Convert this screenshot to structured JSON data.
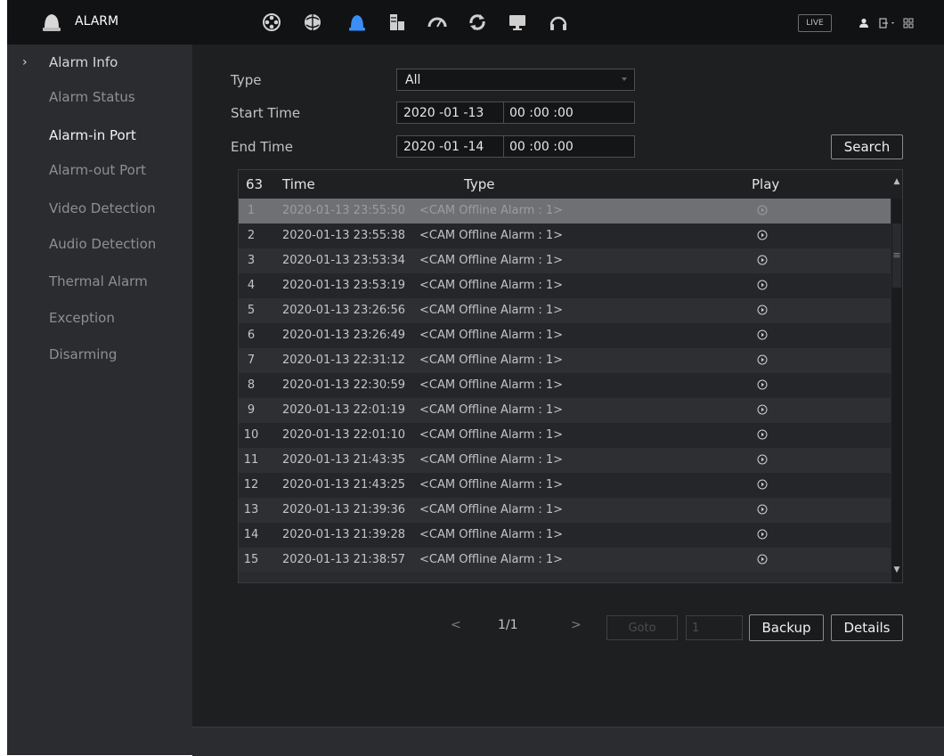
{
  "header": {
    "title": "ALARM",
    "tools": [
      {
        "icon": "camera-reel-icon",
        "label": "Camera"
      },
      {
        "icon": "network-icon",
        "label": "Network"
      },
      {
        "icon": "alarm-bell-icon",
        "label": "Alarm"
      },
      {
        "icon": "storage-icon",
        "label": "Storage"
      },
      {
        "icon": "gauge-icon",
        "label": "System"
      },
      {
        "icon": "refresh-icon",
        "label": "Maintain"
      },
      {
        "icon": "monitor-icon",
        "label": "Display"
      },
      {
        "icon": "headset-icon",
        "label": "Audio"
      }
    ],
    "live_label": "LIVE",
    "active_color": "#3a8ef6"
  },
  "sidebar": {
    "items": [
      {
        "label": "Alarm Info"
      },
      {
        "label": "Alarm Status"
      },
      {
        "label": "Alarm-in Port"
      },
      {
        "label": "Alarm-out Port"
      },
      {
        "label": "Video Detection"
      },
      {
        "label": "Audio Detection"
      },
      {
        "label": "Thermal Alarm"
      },
      {
        "label": "Exception"
      },
      {
        "label": "Disarming"
      }
    ]
  },
  "form": {
    "type_label": "Type",
    "type_value": "All",
    "start_label": "Start Time",
    "start_date": "2020 -01 -13",
    "start_time": "00 :00 :00",
    "end_label": "End Time",
    "end_date": "2020 -01 -14",
    "end_time": "00 :00 :00",
    "search_label": "Search"
  },
  "table": {
    "count": "63",
    "col_time": "Time",
    "col_type": "Type",
    "col_play": "Play",
    "rows": [
      {
        "no": "1",
        "time": "2020-01-13 23:55:50",
        "type": "<CAM Offline Alarm : 1>"
      },
      {
        "no": "2",
        "time": "2020-01-13 23:55:38",
        "type": "<CAM Offline Alarm : 1>"
      },
      {
        "no": "3",
        "time": "2020-01-13 23:53:34",
        "type": "<CAM Offline Alarm : 1>"
      },
      {
        "no": "4",
        "time": "2020-01-13 23:53:19",
        "type": "<CAM Offline Alarm : 1>"
      },
      {
        "no": "5",
        "time": "2020-01-13 23:26:56",
        "type": "<CAM Offline Alarm : 1>"
      },
      {
        "no": "6",
        "time": "2020-01-13 23:26:49",
        "type": "<CAM Offline Alarm : 1>"
      },
      {
        "no": "7",
        "time": "2020-01-13 22:31:12",
        "type": "<CAM Offline Alarm : 1>"
      },
      {
        "no": "8",
        "time": "2020-01-13 22:30:59",
        "type": "<CAM Offline Alarm : 1>"
      },
      {
        "no": "9",
        "time": "2020-01-13 22:01:19",
        "type": "<CAM Offline Alarm : 1>"
      },
      {
        "no": "10",
        "time": "2020-01-13 22:01:10",
        "type": "<CAM Offline Alarm : 1>"
      },
      {
        "no": "11",
        "time": "2020-01-13 21:43:35",
        "type": "<CAM Offline Alarm : 1>"
      },
      {
        "no": "12",
        "time": "2020-01-13 21:43:25",
        "type": "<CAM Offline Alarm : 1>"
      },
      {
        "no": "13",
        "time": "2020-01-13 21:39:36",
        "type": "<CAM Offline Alarm : 1>"
      },
      {
        "no": "14",
        "time": "2020-01-13 21:39:28",
        "type": "<CAM Offline Alarm : 1>"
      },
      {
        "no": "15",
        "time": "2020-01-13 21:38:57",
        "type": "<CAM Offline Alarm : 1>"
      }
    ]
  },
  "pager": {
    "prev": "<",
    "page": "1/1",
    "next": ">",
    "goto_label": "Goto",
    "page_input": "1",
    "backup_label": "Backup",
    "details_label": "Details"
  }
}
